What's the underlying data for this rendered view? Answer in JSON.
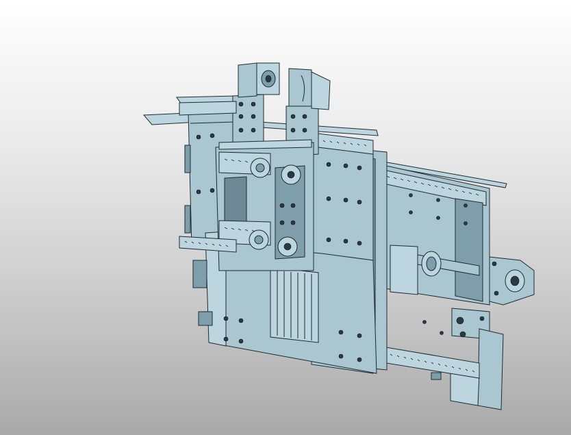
{
  "viewport": {
    "background_top": "#ffffff",
    "background_bottom": "#a9a9a9",
    "part_color": "#a9c6d1",
    "edge_color": "#1e2a30"
  }
}
